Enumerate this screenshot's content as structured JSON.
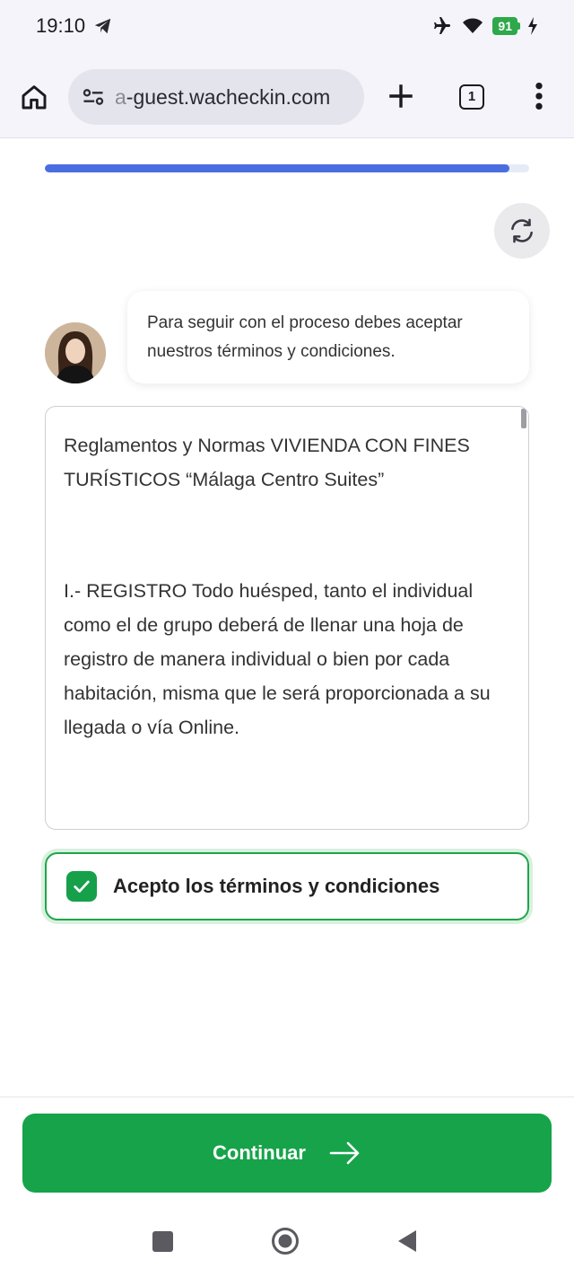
{
  "status_bar": {
    "time": "19:10",
    "battery": "91",
    "icons": [
      "telegram-icon",
      "airplane-icon",
      "wifi-icon",
      "battery-icon",
      "charging-icon"
    ]
  },
  "browser": {
    "url_prefix": "a",
    "url_rest": "-guest.wacheckin.com",
    "tab_count": "1"
  },
  "progress": {
    "percent": 96
  },
  "chat": {
    "message": "Para seguir con el proceso debes aceptar nuestros términos y condiciones."
  },
  "terms": {
    "title": "Reglamentos y Normas VIVIENDA CON FINES TURÍSTICOS “Málaga Centro Suites”",
    "section1": "I.- REGISTRO Todo huésped, tanto el individual como el de grupo deberá de llenar una hoja de registro de manera individual o bien por cada habitación, misma que le será proporcionada a su llegada o vía Online."
  },
  "accept": {
    "label": "Acepto los términos y condiciones",
    "checked": true
  },
  "footer": {
    "continue_label": "Continuar"
  },
  "colors": {
    "accent_green": "#16a34a",
    "progress_blue": "#4a6ee0"
  }
}
